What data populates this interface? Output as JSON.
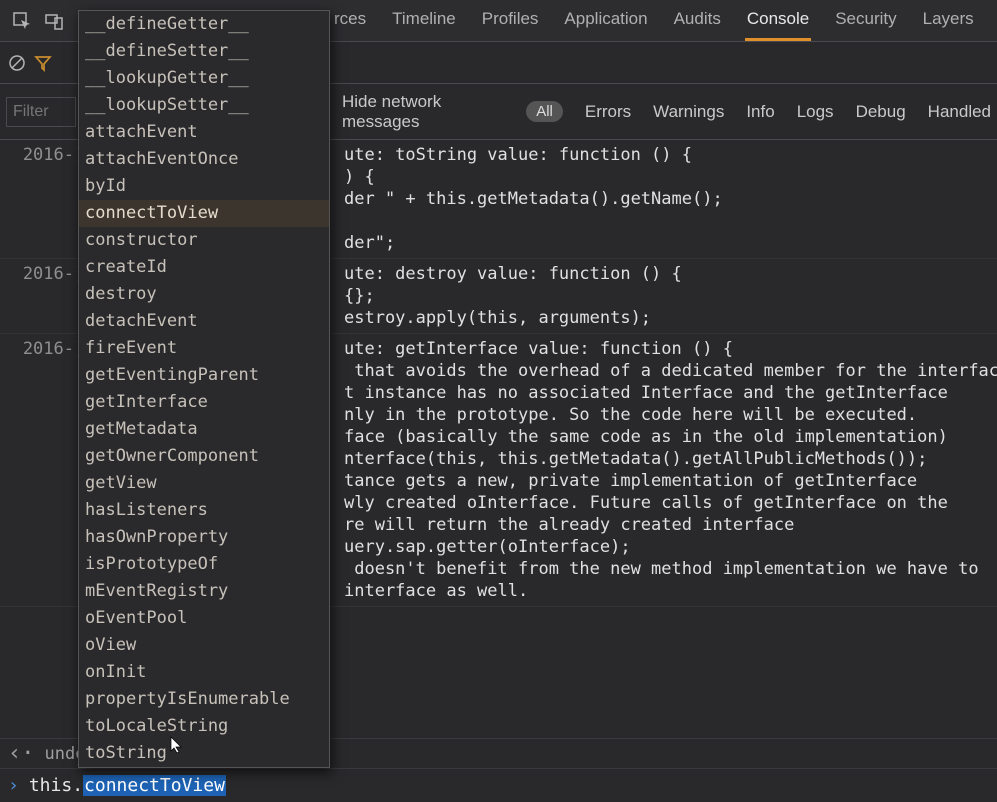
{
  "topbar": {
    "tabs": [
      "rces",
      "Timeline",
      "Profiles",
      "Application",
      "Audits",
      "Console",
      "Security",
      "Layers"
    ],
    "active_tab": "Console"
  },
  "filterbar": {
    "filter_placeholder": "Filter",
    "hide_label": "Hide network messages",
    "pill": "All",
    "levels": [
      "Errors",
      "Warnings",
      "Info",
      "Logs",
      "Debug",
      "Handled"
    ]
  },
  "log": {
    "ts": [
      "2016-",
      "2016-",
      "2016-"
    ],
    "block1": [
      "ute: toString value: function () {",
      ") {",
      "der \" + this.getMetadata().getName();",
      "",
      "der\";",
      ""
    ],
    "block2": [
      "ute: destroy value: function () {",
      "{};",
      "estroy.apply(this, arguments);"
    ],
    "block3": [
      "ute: getInterface value: function () {",
      " that avoids the overhead of a dedicated member for the interface",
      "t instance has no associated Interface and the getInterface",
      "nly in the prototype. So the code here will be executed.",
      "face (basically the same code as in the old implementation)",
      "nterface(this, this.getMetadata().getAllPublicMethods());",
      "tance gets a new, private implementation of getInterface",
      "wly created oInterface. Future calls of getInterface on the",
      "re will return the already created interface",
      "uery.sap.getter(oInterface);",
      " doesn't benefit from the new method implementation we have to",
      "interface as well."
    ]
  },
  "autocomplete": {
    "items": [
      "__defineGetter__",
      "__defineSetter__",
      "__lookupGetter__",
      "__lookupSetter__",
      "attachEvent",
      "attachEventOnce",
      "byId",
      "connectToView",
      "constructor",
      "createId",
      "destroy",
      "detachEvent",
      "fireEvent",
      "getEventingParent",
      "getInterface",
      "getMetadata",
      "getOwnerComponent",
      "getView",
      "hasListeners",
      "hasOwnProperty",
      "isPrototypeOf",
      "mEventRegistry",
      "oEventPool",
      "oView",
      "onInit",
      "propertyIsEnumerable",
      "toLocaleString",
      "toString"
    ],
    "selected": "connectToView"
  },
  "status": {
    "back_icon": "‹",
    "text": "undef"
  },
  "prompt": {
    "prefix": "this.",
    "completion": "connectToView"
  }
}
